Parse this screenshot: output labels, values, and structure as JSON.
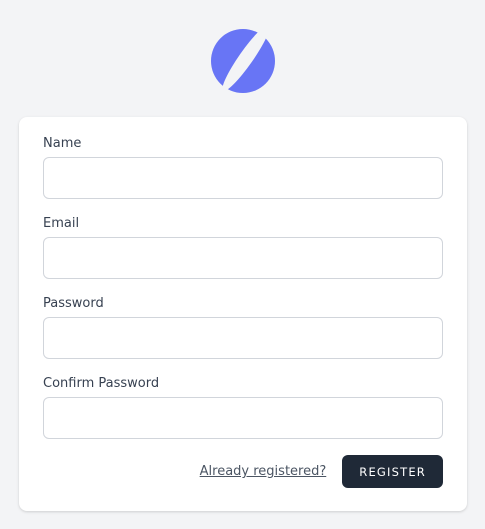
{
  "logo": {
    "icon": "planet-logo-icon",
    "color": "#6875f5"
  },
  "form": {
    "fields": [
      {
        "label": "Name",
        "value": "",
        "placeholder": ""
      },
      {
        "label": "Email",
        "value": "",
        "placeholder": ""
      },
      {
        "label": "Password",
        "value": "",
        "placeholder": ""
      },
      {
        "label": "Confirm Password",
        "value": "",
        "placeholder": ""
      }
    ],
    "login_link": "Already registered?",
    "register_button": "REGISTER"
  },
  "colors": {
    "background": "#f3f4f6",
    "button": "#1f2937",
    "accent": "#6875f5"
  }
}
